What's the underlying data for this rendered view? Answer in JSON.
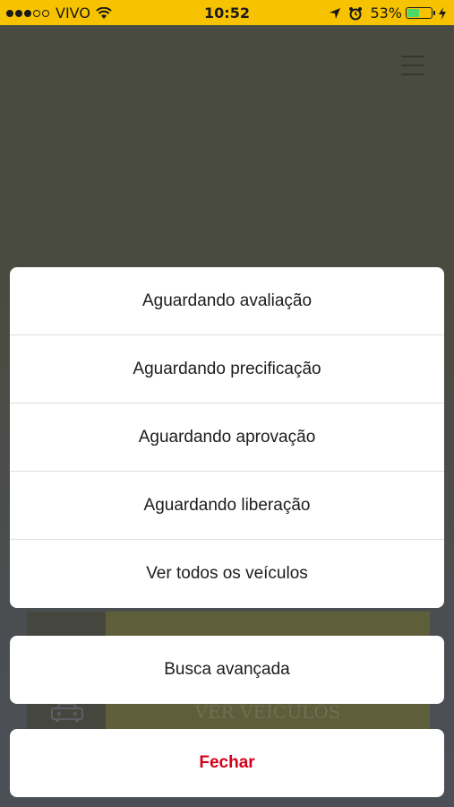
{
  "status_bar": {
    "carrier": "VIVO",
    "time": "10:52",
    "battery_percent": "53%",
    "battery_level": 0.53,
    "background_color": "#f7c300"
  },
  "background_app": {
    "card_button_label": "VER VEÍCULOS"
  },
  "action_sheet": {
    "options": [
      {
        "label": "Aguardando avaliação"
      },
      {
        "label": "Aguardando precificação"
      },
      {
        "label": "Aguardando aprovação"
      },
      {
        "label": "Aguardando liberação"
      },
      {
        "label": "Ver todos os veículos"
      }
    ],
    "secondary": {
      "label": "Busca avançada"
    },
    "cancel": {
      "label": "Fechar",
      "color": "#d0021b"
    }
  }
}
